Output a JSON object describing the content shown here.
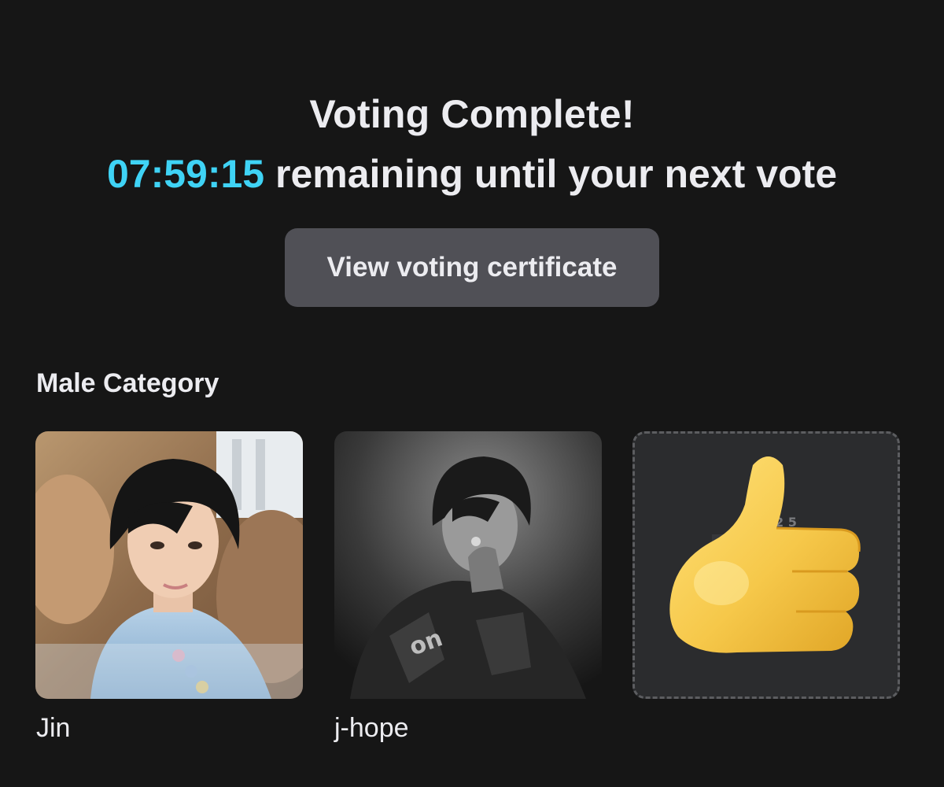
{
  "header": {
    "title": "Voting Complete!",
    "timer": "07:59:15",
    "countdown_suffix": " remaining until your next vote"
  },
  "certificate_button": {
    "label": "View voting certificate"
  },
  "category": {
    "title": "Male Category",
    "candidates": [
      {
        "name": "Jin",
        "photo": "photo-jin"
      },
      {
        "name": "j-hope",
        "photo": "photo-jhope"
      }
    ],
    "empty_slot_icon": "thumbs-up-icon"
  },
  "colors": {
    "background": "#161616",
    "timer_accent": "#3fd3f5",
    "button_bg": "#505056",
    "empty_slot_bg": "#2b2c2e"
  }
}
